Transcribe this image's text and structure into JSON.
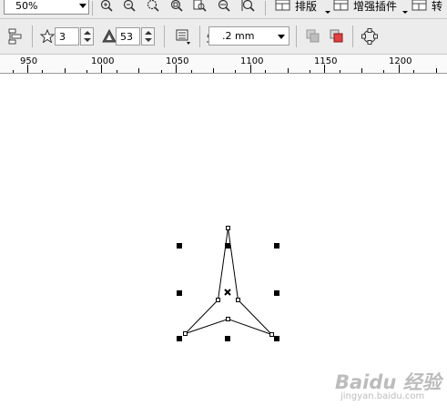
{
  "toolbar_top": {
    "zoom_value": "50%",
    "layout_menu_label": "排版",
    "plugins_menu_label": "增强插件",
    "convert_menu_label": "转"
  },
  "property_bar": {
    "star_points_value": "3",
    "star_sharpness_value": "53",
    "outline_width_value": ".2 mm"
  },
  "ruler": {
    "labels": [
      "950",
      "1000",
      "1050",
      "1100",
      "1150",
      "1200"
    ]
  },
  "watermark": {
    "brand": "Baidu 经验",
    "url": "jingyan.baidu.com"
  }
}
